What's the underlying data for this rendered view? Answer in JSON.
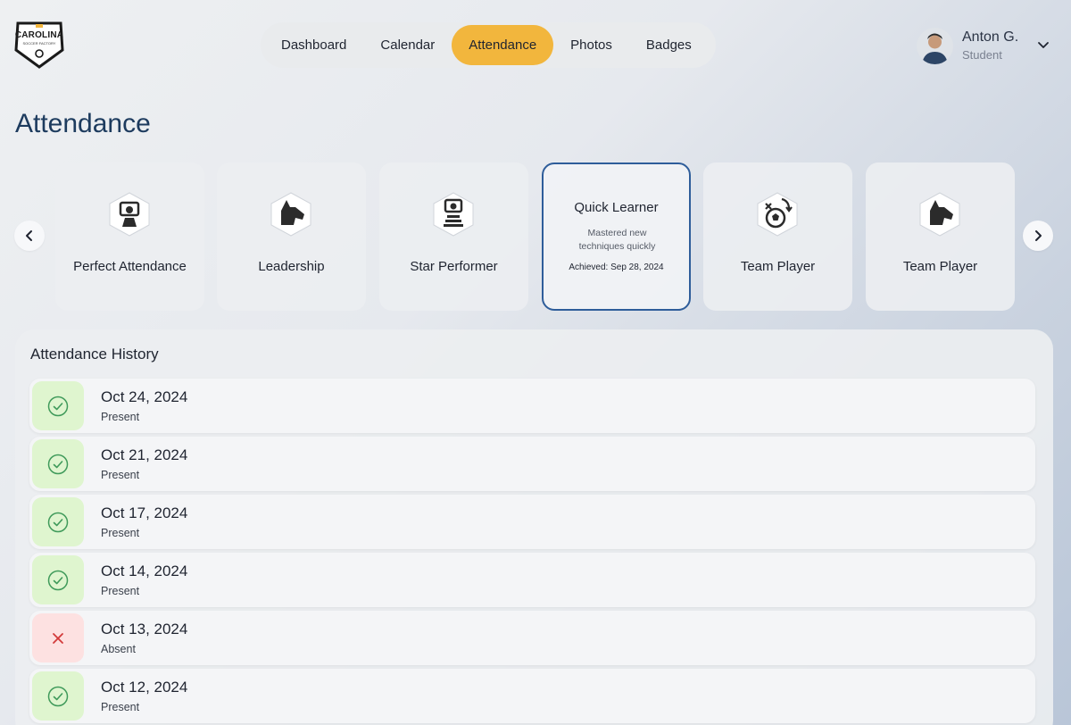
{
  "logo": {
    "text": "CAROLINA",
    "subtext": "SOCCER FACTORY",
    "icon": "shield-logo"
  },
  "nav": {
    "items": [
      {
        "label": "Dashboard",
        "active": false
      },
      {
        "label": "Calendar",
        "active": false
      },
      {
        "label": "Attendance",
        "active": true
      },
      {
        "label": "Photos",
        "active": false
      },
      {
        "label": "Badges",
        "active": false
      }
    ],
    "active_color": "#f2b63d"
  },
  "user": {
    "name": "Anton G.",
    "role": "Student"
  },
  "page": {
    "title": "Attendance"
  },
  "badges": [
    {
      "label": "Perfect Attendance",
      "icon": "trophy-shield-icon"
    },
    {
      "label": "Leadership",
      "icon": "dog-head-icon"
    },
    {
      "label": "Star Performer",
      "icon": "podium-trophy-icon"
    },
    {
      "label": "Quick Learner",
      "description": "Mastered new techniques quickly",
      "achieved": "Achieved: Sep 28, 2024",
      "selected": true
    },
    {
      "label": "Team Player",
      "icon": "soccer-ball-icon"
    },
    {
      "label": "Team Player",
      "icon": "dog-head-icon"
    }
  ],
  "history": {
    "title": "Attendance History",
    "rows": [
      {
        "date": "Oct 24, 2024",
        "status": "Present"
      },
      {
        "date": "Oct 21, 2024",
        "status": "Present"
      },
      {
        "date": "Oct 17, 2024",
        "status": "Present"
      },
      {
        "date": "Oct 14, 2024",
        "status": "Present"
      },
      {
        "date": "Oct 13, 2024",
        "status": "Absent"
      },
      {
        "date": "Oct 12, 2024",
        "status": "Present"
      }
    ]
  },
  "colors": {
    "present_bg": "#dff5cf",
    "present_icon": "#3f9a5a",
    "absent_bg": "#fde1e1",
    "absent_icon": "#d23a3a",
    "title": "#1d3b5e",
    "selected_border": "#2e5d9a"
  }
}
